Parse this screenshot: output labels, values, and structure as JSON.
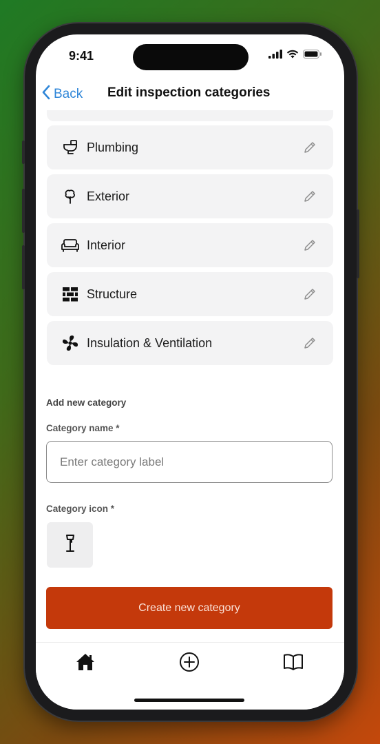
{
  "status_bar": {
    "time": "9:41"
  },
  "nav": {
    "back_label": "Back",
    "title": "Edit inspection categories"
  },
  "categories": [
    {
      "label": "Plumbing",
      "icon": "toilet-icon"
    },
    {
      "label": "Exterior",
      "icon": "tree-icon"
    },
    {
      "label": "Interior",
      "icon": "sofa-icon"
    },
    {
      "label": "Structure",
      "icon": "brick-wall-icon"
    },
    {
      "label": "Insulation & Ventilation",
      "icon": "fan-icon"
    }
  ],
  "form": {
    "section_title": "Add new category",
    "name_label": "Category name *",
    "name_placeholder": "Enter category label",
    "name_value": "",
    "icon_label": "Category icon *",
    "selected_icon": "floor-lamp-icon",
    "submit_label": "Create new category"
  },
  "tab_bar": {
    "tabs": [
      "home-icon",
      "add-circle-icon",
      "book-icon"
    ]
  },
  "colors": {
    "accent": "#c4390b",
    "link": "#2f86d8",
    "card": "#f3f3f4"
  }
}
